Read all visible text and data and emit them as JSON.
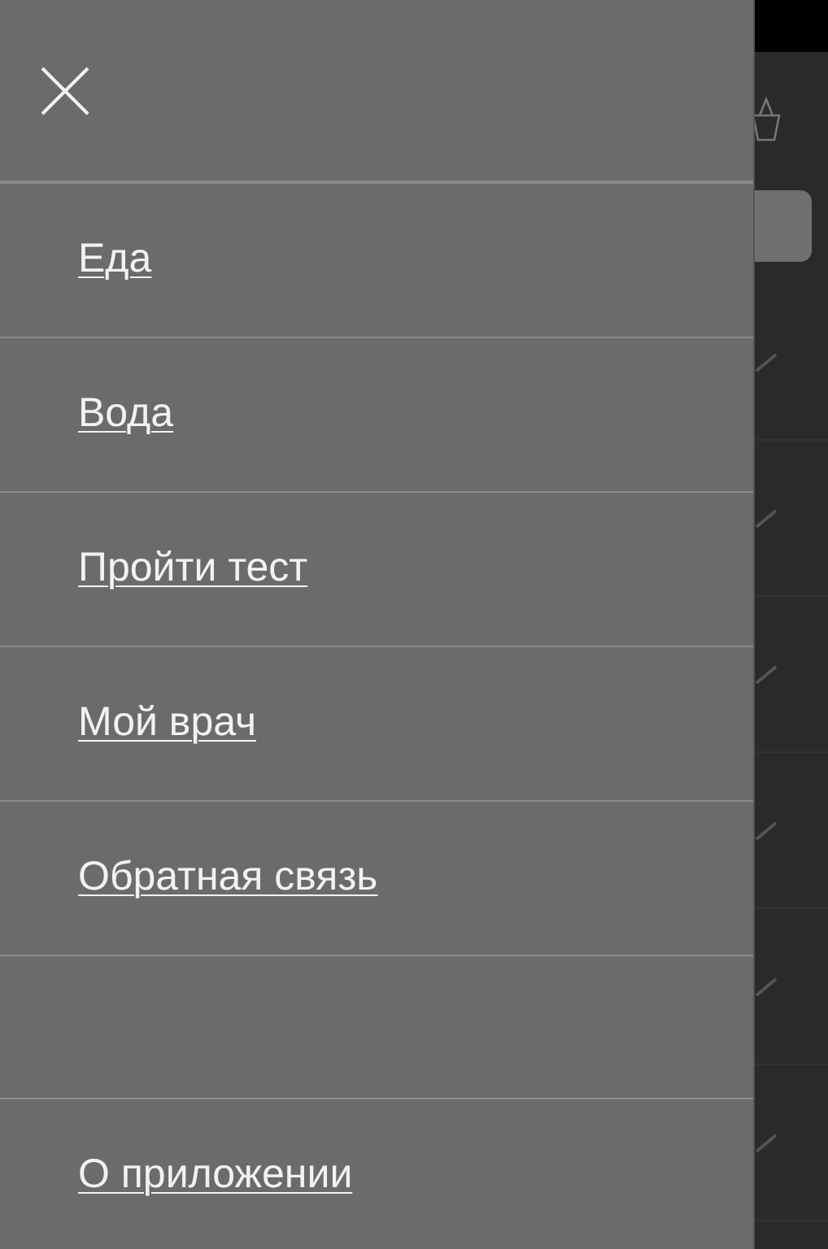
{
  "menu": {
    "items": [
      {
        "label": "Еда",
        "kind": "link"
      },
      {
        "label": "Вода",
        "kind": "link"
      },
      {
        "label": "Пройти тест",
        "kind": "link"
      },
      {
        "label": "Мой врач",
        "kind": "link"
      },
      {
        "label": "Обратная связь",
        "kind": "link"
      },
      {
        "kind": "spacer"
      },
      {
        "label": "О приложении",
        "kind": "link"
      }
    ]
  },
  "background_list": {
    "rows": [
      {
        "checked": true
      },
      {
        "checked": true
      },
      {
        "checked": true
      },
      {
        "checked": true
      },
      {
        "checked": true
      },
      {
        "checked": true
      }
    ]
  }
}
